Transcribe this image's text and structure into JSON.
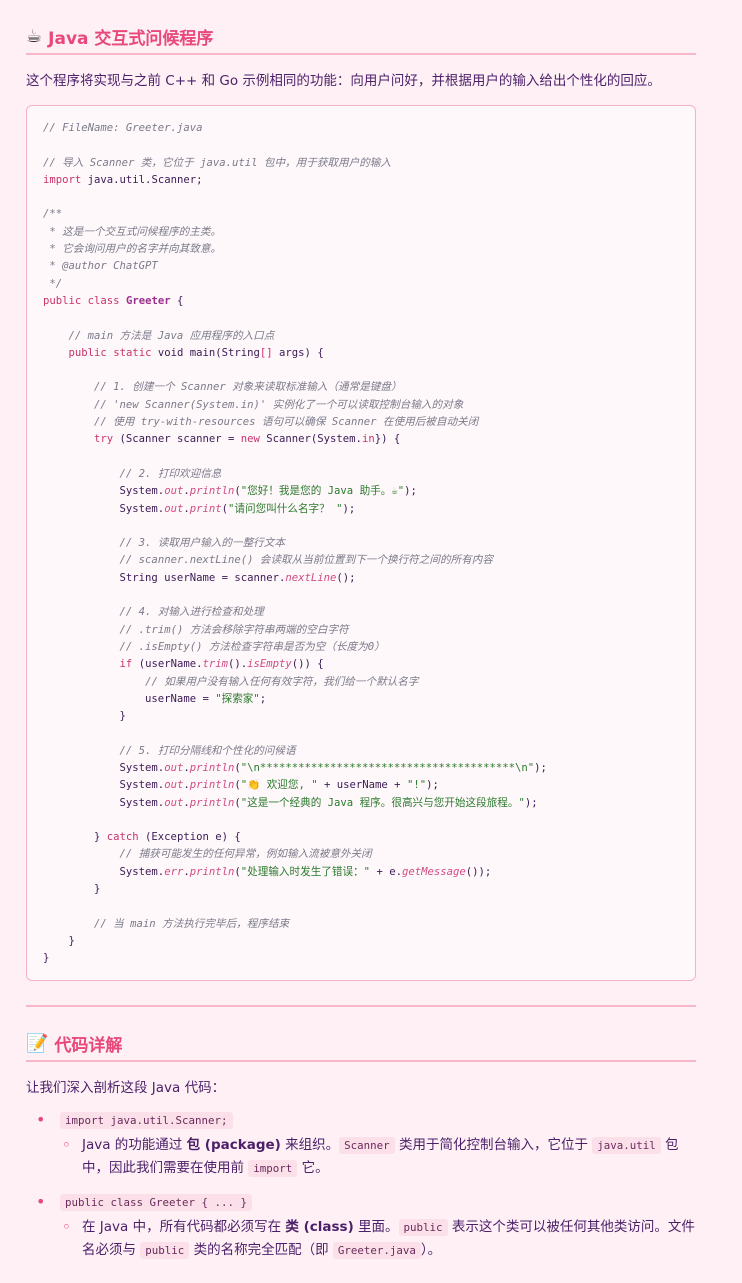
{
  "section1": {
    "icon": "☕",
    "title": "Java 交互式问候程序",
    "intro": "这个程序将实现与之前 C++ 和 Go 示例相同的功能：向用户问好，并根据用户的输入给出个性化的回应。"
  },
  "code": {
    "lines": [
      [
        [
          "c",
          "// FileName: Greeter.java"
        ]
      ],
      [],
      [
        [
          "c",
          "// 导入 Scanner 类，它位于 java.util 包中，用于获取用户的输入"
        ]
      ],
      [
        [
          "k",
          "import"
        ],
        [
          "t",
          " java.util.Scanner;"
        ]
      ],
      [],
      [
        [
          "c",
          "/**"
        ]
      ],
      [
        [
          "c",
          " * 这是一个交互式问候程序的主类。"
        ]
      ],
      [
        [
          "c",
          " * 它会询问用户的名字并向其致意。"
        ]
      ],
      [
        [
          "c",
          " * @author ChatGPT"
        ]
      ],
      [
        [
          "c",
          " */"
        ]
      ],
      [
        [
          "k",
          "public"
        ],
        [
          "t",
          " "
        ],
        [
          "k",
          "class"
        ],
        [
          "t",
          " "
        ],
        [
          "n",
          "Greeter"
        ],
        [
          "t",
          " {"
        ]
      ],
      [],
      [
        [
          "t",
          "    "
        ],
        [
          "c",
          "// main 方法是 Java 应用程序的入口点"
        ]
      ],
      [
        [
          "t",
          "    "
        ],
        [
          "k",
          "public"
        ],
        [
          "t",
          " "
        ],
        [
          "k",
          "static"
        ],
        [
          "t",
          " void main(String"
        ],
        [
          "k",
          "[]"
        ],
        [
          "t",
          " args) {"
        ]
      ],
      [],
      [
        [
          "t",
          "        "
        ],
        [
          "c",
          "// 1. 创建一个 Scanner 对象来读取标准输入（通常是键盘）"
        ]
      ],
      [
        [
          "t",
          "        "
        ],
        [
          "c",
          "// 'new Scanner(System.in)' 实例化了一个可以读取控制台输入的对象"
        ]
      ],
      [
        [
          "t",
          "        "
        ],
        [
          "c",
          "// 使用 try-with-resources 语句可以确保 Scanner 在使用后被自动关闭"
        ]
      ],
      [
        [
          "t",
          "        "
        ],
        [
          "k",
          "try"
        ],
        [
          "t",
          " (Scanner scanner = "
        ],
        [
          "k",
          "new"
        ],
        [
          "t",
          " Scanner(System."
        ],
        [
          "k",
          "in"
        ],
        [
          "t",
          "}) {"
        ]
      ],
      [],
      [
        [
          "t",
          "            "
        ],
        [
          "c",
          "// 2. 打印欢迎信息"
        ]
      ],
      [
        [
          "t",
          "            System."
        ],
        [
          "f",
          "out"
        ],
        [
          "t",
          "."
        ],
        [
          "f",
          "println"
        ],
        [
          "t",
          "("
        ],
        [
          "s",
          "\"您好！我是您的 Java 助手。☕\""
        ],
        [
          "t",
          ");"
        ]
      ],
      [
        [
          "t",
          "            System."
        ],
        [
          "f",
          "out"
        ],
        [
          "t",
          "."
        ],
        [
          "f",
          "print"
        ],
        [
          "t",
          "("
        ],
        [
          "s",
          "\"请问您叫什么名字？ \""
        ],
        [
          "t",
          ");"
        ]
      ],
      [],
      [
        [
          "t",
          "            "
        ],
        [
          "c",
          "// 3. 读取用户输入的一整行文本"
        ]
      ],
      [
        [
          "t",
          "            "
        ],
        [
          "c",
          "// scanner.nextLine() 会读取从当前位置到下一个换行符之间的所有内容"
        ]
      ],
      [
        [
          "t",
          "            String userName = scanner."
        ],
        [
          "f",
          "nextLine"
        ],
        [
          "t",
          "();"
        ]
      ],
      [],
      [
        [
          "t",
          "            "
        ],
        [
          "c",
          "// 4. 对输入进行检查和处理"
        ]
      ],
      [
        [
          "t",
          "            "
        ],
        [
          "c",
          "// .trim() 方法会移除字符串两端的空白字符"
        ]
      ],
      [
        [
          "t",
          "            "
        ],
        [
          "c",
          "// .isEmpty() 方法检查字符串是否为空（长度为0）"
        ]
      ],
      [
        [
          "t",
          "            "
        ],
        [
          "k",
          "if"
        ],
        [
          "t",
          " (userName."
        ],
        [
          "f",
          "trim"
        ],
        [
          "t",
          "()."
        ],
        [
          "f",
          "isEmpty"
        ],
        [
          "t",
          "()) {"
        ]
      ],
      [
        [
          "t",
          "                "
        ],
        [
          "c",
          "// 如果用户没有输入任何有效字符，我们给一个默认名字"
        ]
      ],
      [
        [
          "t",
          "                userName = "
        ],
        [
          "s",
          "\"探索家\""
        ],
        [
          "t",
          ";"
        ]
      ],
      [
        [
          "t",
          "            }"
        ]
      ],
      [],
      [
        [
          "t",
          "            "
        ],
        [
          "c",
          "// 5. 打印分隔线和个性化的问候语"
        ]
      ],
      [
        [
          "t",
          "            System."
        ],
        [
          "f",
          "out"
        ],
        [
          "t",
          "."
        ],
        [
          "f",
          "println"
        ],
        [
          "t",
          "("
        ],
        [
          "s",
          "\"\\n****************************************\\n\""
        ],
        [
          "t",
          ");"
        ]
      ],
      [
        [
          "t",
          "            System."
        ],
        [
          "f",
          "out"
        ],
        [
          "t",
          "."
        ],
        [
          "f",
          "println"
        ],
        [
          "t",
          "("
        ],
        [
          "s",
          "\"👏 欢迎您, \""
        ],
        [
          "t",
          " + userName + "
        ],
        [
          "s",
          "\"!\""
        ],
        [
          "t",
          ");"
        ]
      ],
      [
        [
          "t",
          "            System."
        ],
        [
          "f",
          "out"
        ],
        [
          "t",
          "."
        ],
        [
          "f",
          "println"
        ],
        [
          "t",
          "("
        ],
        [
          "s",
          "\"这是一个经典的 Java 程序。很高兴与您开始这段旅程。\""
        ],
        [
          "t",
          ");"
        ]
      ],
      [],
      [
        [
          "t",
          "        } "
        ],
        [
          "k",
          "catch"
        ],
        [
          "t",
          " (Exception e) {"
        ]
      ],
      [
        [
          "t",
          "            "
        ],
        [
          "c",
          "// 捕获可能发生的任何异常，例如输入流被意外关闭"
        ]
      ],
      [
        [
          "t",
          "            System."
        ],
        [
          "f",
          "err"
        ],
        [
          "t",
          "."
        ],
        [
          "f",
          "println"
        ],
        [
          "t",
          "("
        ],
        [
          "s",
          "\"处理输入时发生了错误：\""
        ],
        [
          "t",
          " + e."
        ],
        [
          "f",
          "getMessage"
        ],
        [
          "t",
          "());"
        ]
      ],
      [
        [
          "t",
          "        }"
        ]
      ],
      [],
      [
        [
          "t",
          "        "
        ],
        [
          "c",
          "// 当 main 方法执行完毕后，程序结束"
        ]
      ],
      [
        [
          "t",
          "    }"
        ]
      ],
      [
        [
          "t",
          "}"
        ]
      ]
    ]
  },
  "section2": {
    "icon": "📝",
    "title": "代码详解",
    "intro": "让我们深入剖析这段 Java 代码："
  },
  "bullets": [
    {
      "code": "import java.util.Scanner;",
      "sub": [
        [
          "Java 的功能通过 ",
          "b:包 (package)",
          " 来组织。",
          "c:Scanner",
          " 类用于简化控制台输入，它位于 ",
          "c:java.util",
          " 包中，因此我们需要在使用前 ",
          "c:import",
          " 它。"
        ]
      ]
    },
    {
      "code": "public class Greeter { ... }",
      "sub": [
        [
          "在 Java 中，所有代码都必须写在 ",
          "b:类 (class)",
          " 里面。",
          "c:public",
          " 表示这个类可以被任何其他类访问。文件名必须与 ",
          "c:public",
          " 类的名称完全匹配（即 ",
          "c:Greeter.java",
          "）。"
        ]
      ]
    }
  ]
}
